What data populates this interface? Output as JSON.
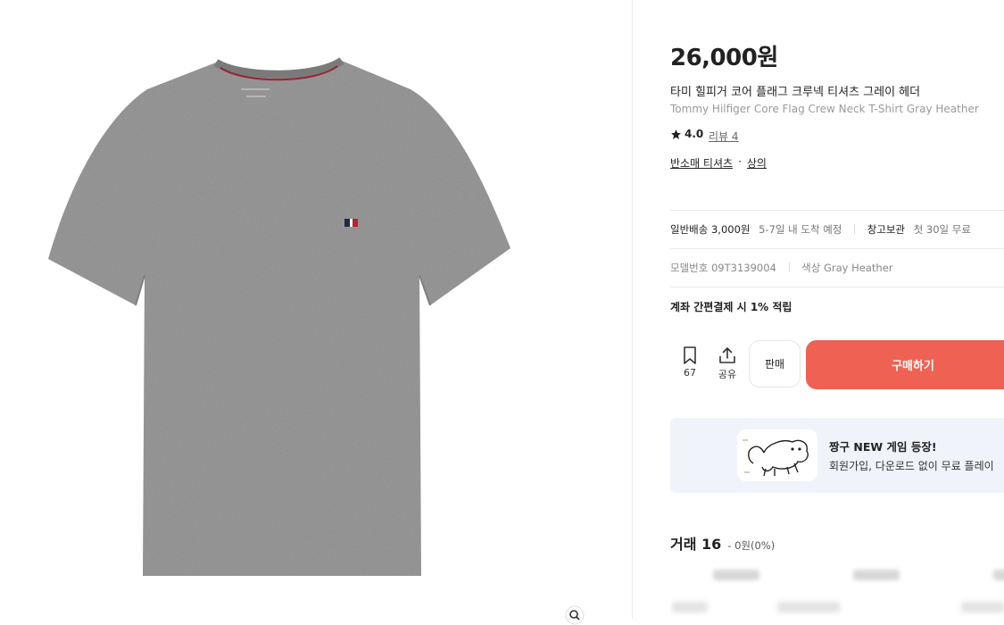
{
  "product": {
    "price": "26,000원",
    "name_ko": "타미 힐피거 코어 플래그 크루넥 티셔츠 그레이 헤더",
    "name_en": "Tommy Hilfiger Core Flag Crew Neck T-Shirt Gray Heather",
    "rating": "4.0",
    "review_label": "리뷰 4",
    "categories": [
      "반소매 티셔츠",
      "상의"
    ],
    "category_separator": "·"
  },
  "shipping": {
    "label": "일반배송 3,000원",
    "eta": "5-7일 내 도착 예정",
    "storage_label": "창고보관",
    "storage_note": "첫 30일 무료"
  },
  "details": {
    "model_label": "모델번호 09T3139004",
    "color_label": "색상 Gray Heather"
  },
  "points_note": "계좌 간편결제 시 1% 적립",
  "actions": {
    "bookmark_count": "67",
    "share_label": "공유",
    "sell_label": "판매",
    "buy_label": "구매하기"
  },
  "banner": {
    "title": "짱구 NEW 게임 등장!",
    "subtitle": "회원가입, 다운로드 없이 무료 플레이"
  },
  "trades": {
    "title": "거래 16",
    "change": "- 0원(0%)"
  },
  "colors": {
    "accent": "#ef6253",
    "tshirt": "#8f8f8f",
    "banner_bg": "#f0f3fa"
  },
  "icons": {
    "bookmark": "bookmark-icon",
    "share": "share-icon",
    "zoom": "zoom-icon",
    "star": "star-icon"
  }
}
